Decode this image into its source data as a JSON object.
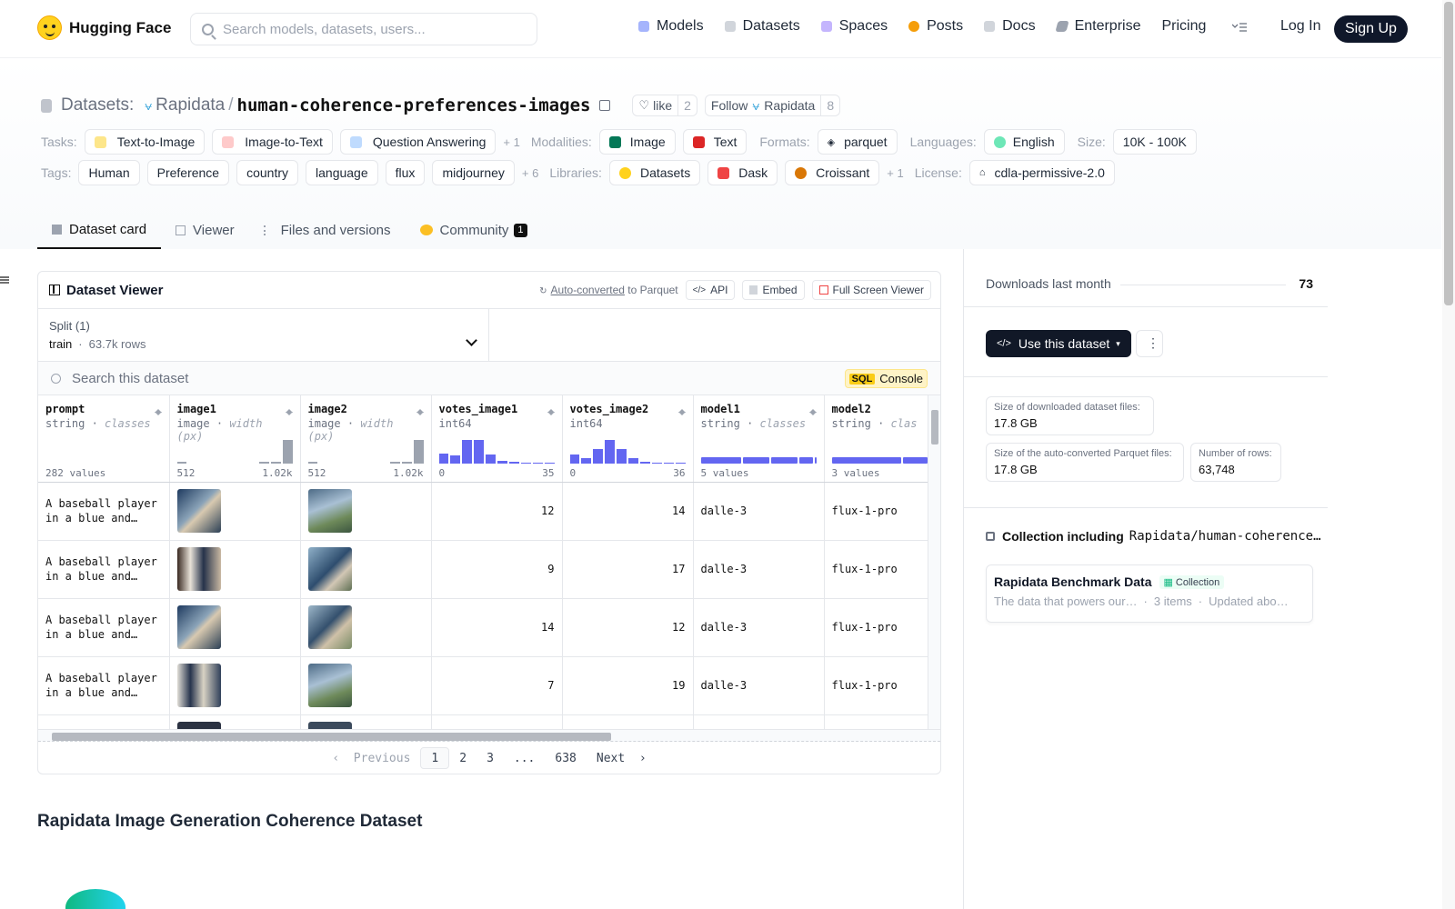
{
  "nav": {
    "brand": "Hugging Face",
    "search_placeholder": "Search models, datasets, users...",
    "links": [
      "Models",
      "Datasets",
      "Spaces",
      "Posts",
      "Docs",
      "Enterprise",
      "Pricing"
    ],
    "login": "Log In",
    "signup": "Sign Up"
  },
  "header": {
    "section": "Datasets:",
    "org": "Rapidata",
    "repo": "human-coherence-preferences-images",
    "like_label": "like",
    "like_count": "2",
    "follow_label": "Follow",
    "follow_org": "Rapidata",
    "follow_count": "8"
  },
  "meta": {
    "tasks_label": "Tasks:",
    "tasks": [
      "Text-to-Image",
      "Image-to-Text",
      "Question Answering"
    ],
    "tasks_more": "+ 1",
    "modalities_label": "Modalities:",
    "modalities": [
      "Image",
      "Text"
    ],
    "formats_label": "Formats:",
    "format": "parquet",
    "languages_label": "Languages:",
    "language": "English",
    "size_label": "Size:",
    "size": "10K - 100K",
    "tags_label": "Tags:",
    "tags": [
      "Human",
      "Preference",
      "country",
      "language",
      "flux",
      "midjourney"
    ],
    "tags_more": "+ 6",
    "libraries_label": "Libraries:",
    "libraries": [
      "Datasets",
      "Dask",
      "Croissant"
    ],
    "libraries_more": "+ 1",
    "license_label": "License:",
    "license": "cdla-permissive-2.0"
  },
  "tabs": [
    {
      "label": "Dataset card"
    },
    {
      "label": "Viewer"
    },
    {
      "label": "Files and versions"
    },
    {
      "label": "Community",
      "badge": "1"
    }
  ],
  "viewer": {
    "title": "Dataset Viewer",
    "autoconverted": "Auto-converted",
    "to_parquet": " to Parquet",
    "api": "API",
    "embed": "Embed",
    "fullscreen": "Full Screen Viewer",
    "split_label": "Split (1)",
    "split_name": "train",
    "split_rows": "63.7k rows",
    "search_placeholder": "Search this dataset",
    "sql": "SQL",
    "console": "Console",
    "columns": [
      {
        "name": "prompt",
        "type": "string",
        "sub": "classes",
        "foot_left": "282 values",
        "foot_right": ""
      },
      {
        "name": "image1",
        "type": "image",
        "sub": "width (px)",
        "foot_left": "512",
        "foot_right": "1.02k"
      },
      {
        "name": "image2",
        "type": "image",
        "sub": "width (px)",
        "foot_left": "512",
        "foot_right": "1.02k"
      },
      {
        "name": "votes_image1",
        "type": "int64",
        "sub": "",
        "foot_left": "0",
        "foot_right": "35"
      },
      {
        "name": "votes_image2",
        "type": "int64",
        "sub": "",
        "foot_left": "0",
        "foot_right": "36"
      },
      {
        "name": "model1",
        "type": "string",
        "sub": "classes",
        "foot_left": "5 values",
        "foot_right": ""
      },
      {
        "name": "model2",
        "type": "string",
        "sub": "clas",
        "foot_left": "3 values",
        "foot_right": ""
      }
    ],
    "rows": [
      {
        "prompt": "A baseball player in a blue and…",
        "v1": "12",
        "v2": "14",
        "m1": "dalle-3",
        "m2": "flux-1-pro"
      },
      {
        "prompt": "A baseball player in a blue and…",
        "v1": "9",
        "v2": "17",
        "m1": "dalle-3",
        "m2": "flux-1-pro"
      },
      {
        "prompt": "A baseball player in a blue and…",
        "v1": "14",
        "v2": "12",
        "m1": "dalle-3",
        "m2": "flux-1-pro"
      },
      {
        "prompt": "A baseball player in a blue and…",
        "v1": "7",
        "v2": "19",
        "m1": "dalle-3",
        "m2": "flux-1-pro"
      }
    ],
    "pager": {
      "prev": "Previous",
      "pages": [
        "1",
        "2",
        "3",
        "...",
        "638"
      ],
      "next": "Next"
    }
  },
  "card": {
    "heading": "Rapidata Image Generation Coherence Dataset"
  },
  "sidebar": {
    "downloads_label": "Downloads last month",
    "downloads": "73",
    "use_button": "Use this dataset",
    "dl_size_label": "Size of downloaded dataset files:",
    "dl_size": "17.8 GB",
    "parquet_size_label": "Size of the auto-converted Parquet files:",
    "parquet_size": "17.8 GB",
    "rows_label": "Number of rows:",
    "rows": "63,748",
    "collection_heading": "Collection including",
    "collection_repo": "Rapidata/human-coherence…",
    "collection_name": "Rapidata Benchmark Data",
    "collection_chip": "Collection",
    "collection_desc": "The data that powers our…",
    "collection_items": "3 items",
    "collection_updated": "Updated abo…"
  },
  "colors": {
    "accent_bar": "#6366f1",
    "signup_bg": "#0f172a"
  }
}
